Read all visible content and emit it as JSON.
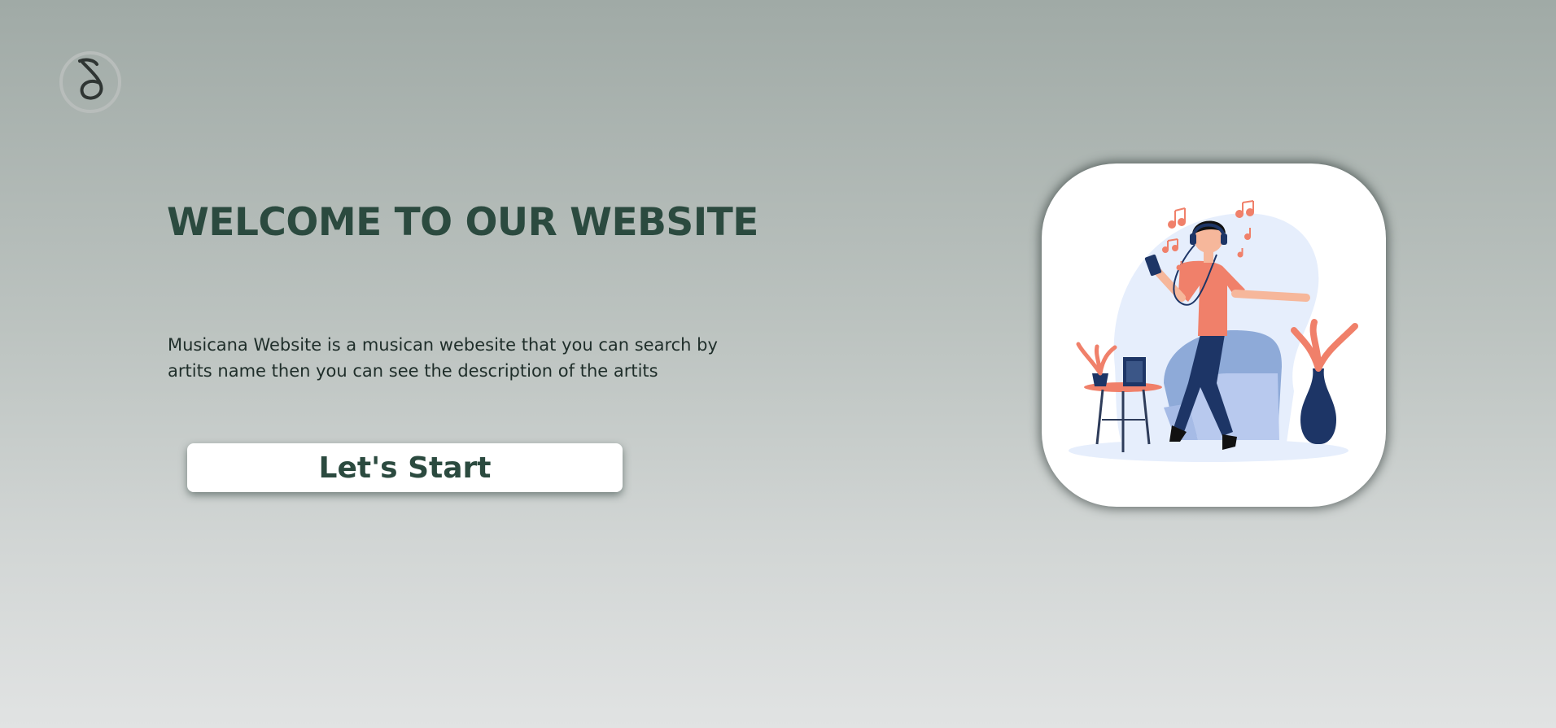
{
  "logo": {
    "icon": "music-note-logo-icon",
    "color": "#2f3533"
  },
  "hero": {
    "title": "WELCOME TO OUR WEBSITE",
    "description": "Musicana Website is a musican webesite that you can search by artits name then you can see the description of the artits",
    "cta_label": "Let's Start",
    "illustration": "person-dancing-with-headphones-illustration"
  },
  "colors": {
    "accent": "#2b4a3f",
    "text": "#1f2e2a",
    "illustration_coral": "#f0806a",
    "illustration_navy": "#1d3566",
    "illustration_light_blue": "#b8c9ee"
  }
}
